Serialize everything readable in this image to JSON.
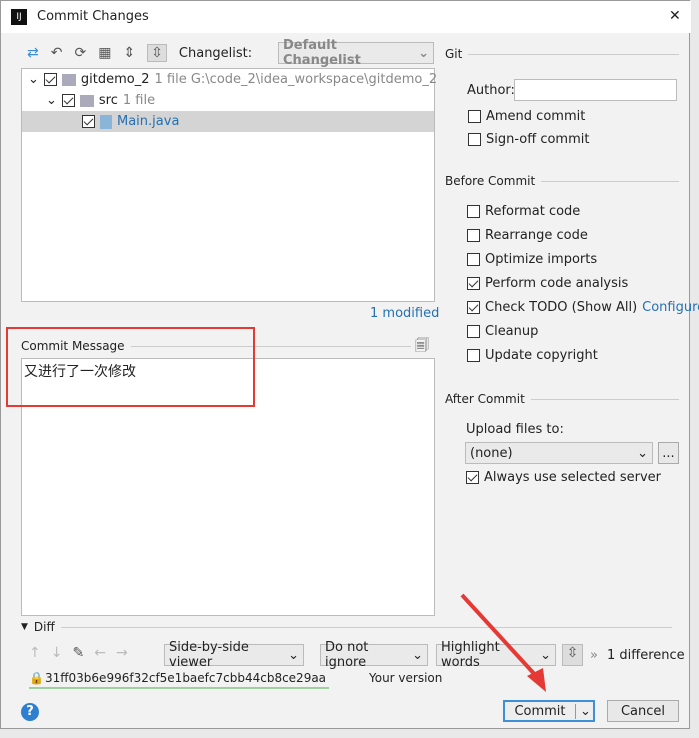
{
  "window": {
    "title": "Commit Changes",
    "close": "✕"
  },
  "toolbar": {
    "changelist_label": "Changelist:",
    "changelist_value": "Default Changelist"
  },
  "tree": [
    {
      "name": "gitdemo_2",
      "meta": "1 file  G:\\code_2\\idea_workspace\\gitdemo_2"
    },
    {
      "name": "src",
      "meta": "1 file"
    },
    {
      "name": "Main.java",
      "meta": ""
    }
  ],
  "modified": "1 modified",
  "commit_message": {
    "label": "Commit Message",
    "value": "又进行了一次修改"
  },
  "git": {
    "section": "Git",
    "author_label": "Author:",
    "author_value": "",
    "amend": "Amend commit",
    "signoff": "Sign-off commit"
  },
  "before": {
    "section": "Before Commit",
    "items": [
      {
        "label": "Reformat code",
        "checked": false
      },
      {
        "label": "Rearrange code",
        "checked": false
      },
      {
        "label": "Optimize imports",
        "checked": false
      },
      {
        "label": "Perform code analysis",
        "checked": true
      },
      {
        "label": "Check TODO (Show All)",
        "checked": true,
        "link": "Configure"
      },
      {
        "label": "Cleanup",
        "checked": false
      },
      {
        "label": "Update copyright",
        "checked": false
      }
    ]
  },
  "after": {
    "section": "After Commit",
    "upload_label": "Upload files to:",
    "upload_value": "(none)",
    "more": "...",
    "always": "Always use selected server"
  },
  "diff": {
    "section": "Diff",
    "viewer": "Side-by-side viewer",
    "ignore": "Do not ignore",
    "highlight": "Highlight words",
    "count": "1 difference",
    "hash": "31ff03b6e996f32cf5e1baefc7cbb44cb8ce29aa",
    "your_version": "Your version"
  },
  "buttons": {
    "commit": "Commit",
    "cancel": "Cancel",
    "help": "?"
  },
  "colors": {
    "annotation": "#e53935",
    "link": "#2470b3",
    "focus": "#3d8fd8"
  }
}
